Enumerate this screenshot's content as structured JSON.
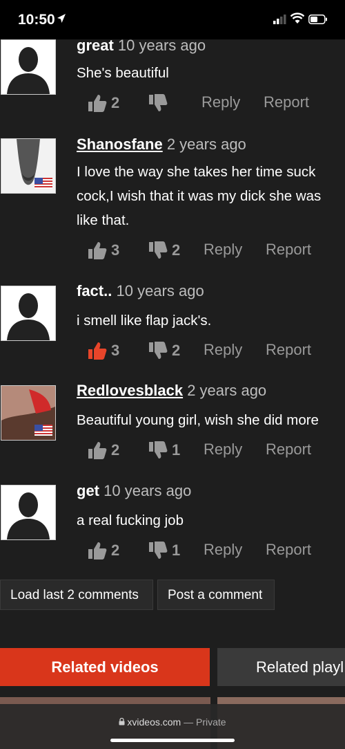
{
  "status_bar": {
    "time": "10:50",
    "icons": [
      "location-arrow-icon",
      "cellular-signal-icon",
      "wifi-icon",
      "battery-icon"
    ]
  },
  "comments": [
    {
      "author": "great",
      "date": "10 years ago",
      "text": [
        "She's beautiful"
      ],
      "likes": "2",
      "dislikes": "",
      "reply": "Reply",
      "report": "Report",
      "avatar": "default-silhouette"
    },
    {
      "author": "Shanosfane",
      "date": "2 years ago",
      "text": [
        "I love the way she takes her time suck",
        "cock,I wish that it was my dick she was",
        "like that."
      ],
      "likes": "3",
      "dislikes": "2",
      "reply": "Reply",
      "report": "Report",
      "avatar": "user-photo-with-us-flag"
    },
    {
      "author": "fact..",
      "date": "10 years ago",
      "text": [
        "i smell like flap jack's."
      ],
      "likes": "3",
      "dislikes": "2",
      "reply": "Reply",
      "report": "Report",
      "avatar": "default-silhouette"
    },
    {
      "author": "Redlovesblack",
      "date": "2 years ago",
      "text": [
        "Beautiful young girl, wish she did more"
      ],
      "likes": "2",
      "dislikes": "1",
      "reply": "Reply",
      "report": "Report",
      "avatar": "user-photo-with-us-flag"
    },
    {
      "author": "get",
      "date": "10 years ago",
      "text": [
        "a real fucking job"
      ],
      "likes": "2",
      "dislikes": "1",
      "reply": "Reply",
      "report": "Report",
      "avatar": "default-silhouette"
    }
  ],
  "buttons": {
    "load_more": "Load last 2 comments",
    "post_comment": "Post a comment"
  },
  "tabs": {
    "related_videos": "Related videos",
    "related_playlists": "Related playl"
  },
  "browser": {
    "domain": "xvideos.com",
    "separator": "—",
    "mode": "Private"
  },
  "colors": {
    "accent": "#d9361b",
    "liked": "#e8452a",
    "background": "#1e1e1e"
  }
}
